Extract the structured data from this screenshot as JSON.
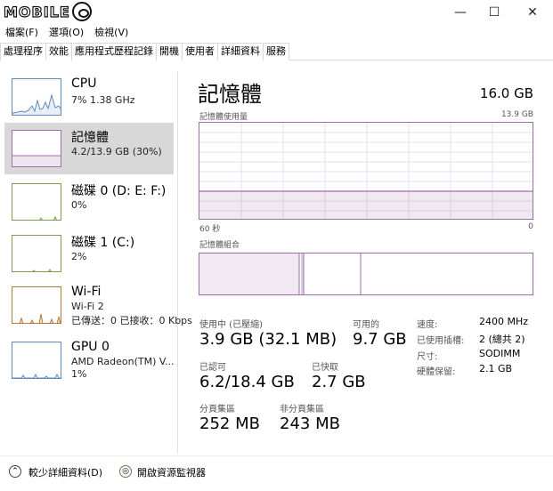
{
  "watermark": "MOBILE",
  "window": {
    "minimize_icon": "minimize-icon",
    "maximize_icon": "maximize-icon",
    "close_icon": "close-icon"
  },
  "menu": [
    "檔案(F)",
    "選項(O)",
    "檢視(V)"
  ],
  "tabs": [
    "處理程序",
    "效能",
    "應用程式歷程記錄",
    "開機",
    "使用者",
    "詳細資料",
    "服務"
  ],
  "active_tab": "效能",
  "sidebar": [
    {
      "title": "CPU",
      "lines": [
        "7% 1.38 GHz"
      ]
    },
    {
      "title": "記憶體",
      "lines": [
        "4.2/13.9 GB (30%)"
      ]
    },
    {
      "title": "磁碟 0 (D: E: F:)",
      "lines": [
        "0%"
      ]
    },
    {
      "title": "磁碟 1 (C:)",
      "lines": [
        "2%"
      ]
    },
    {
      "title": "Wi-Fi",
      "lines": [
        "Wi-Fi 2",
        "已傳送：0 已接收：0 Kbps"
      ]
    },
    {
      "title": "GPU 0",
      "lines": [
        "AMD Radeon(TM) V...",
        "1%"
      ]
    }
  ],
  "main": {
    "title": "記憶體",
    "total": "16.0 GB",
    "usage_label": "記憶體使用量",
    "usage_max": "13.9 GB",
    "time_left": "60 秒",
    "time_right": "0",
    "composition_label": "記憶體組合"
  },
  "stats": {
    "in_use_label": "使用中 (已壓縮)",
    "in_use_value": "3.9 GB (32.1 MB)",
    "available_label": "可用的",
    "available_value": "9.7 GB",
    "committed_label": "已認可",
    "committed_value": "6.2/18.4 GB",
    "cached_label": "已快取",
    "cached_value": "2.7 GB",
    "paged_label": "分頁集區",
    "paged_value": "252 MB",
    "nonpaged_label": "非分頁集區",
    "nonpaged_value": "243 MB"
  },
  "details": [
    {
      "label": "速度:",
      "value": "2400 MHz"
    },
    {
      "label": "已使用插槽:",
      "value": "2 (總共 2)"
    },
    {
      "label": "尺寸:",
      "value": "SODIMM"
    },
    {
      "label": "硬體保留:",
      "value": "2.1 GB"
    }
  ],
  "footer": {
    "fewer_details": "較少詳細資料(D)",
    "open_monitor": "開啟資源監視器"
  },
  "colors": {
    "memory_accent": "#9c6ea8",
    "cpu_accent": "#5d8bbf",
    "disk_accent": "#7aa04a",
    "wifi_accent": "#b07a3a"
  }
}
